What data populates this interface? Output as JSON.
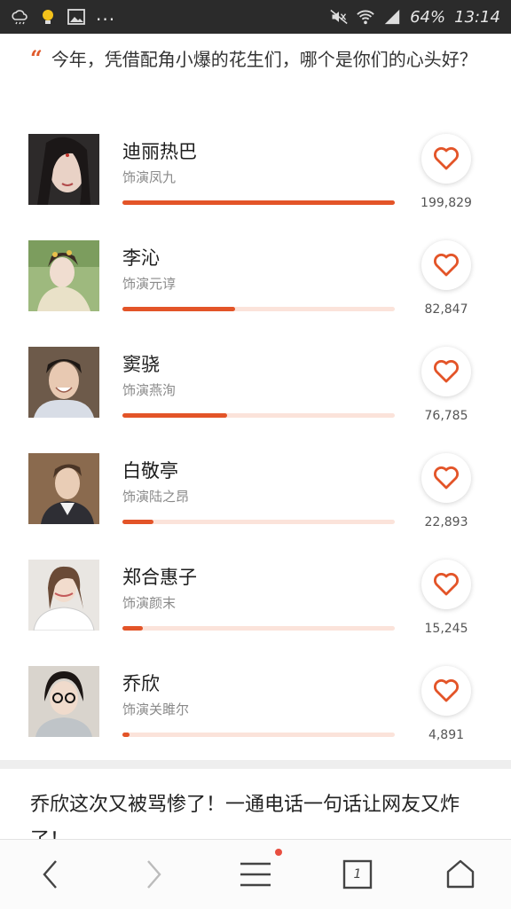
{
  "status_bar": {
    "battery": "64%",
    "time": "13:14",
    "more": "..."
  },
  "question": {
    "mark": "“",
    "text": "今年，凭借配角小爆的花生们，哪个是你们的心头好？"
  },
  "candidates": [
    {
      "name": "迪丽热巴",
      "role": "饰演凤九",
      "votes": "199,829",
      "progress": 1.0
    },
    {
      "name": "李沁",
      "role": "饰演元谆",
      "votes": "82,847",
      "progress": 0.415
    },
    {
      "name": "窦骁",
      "role": "饰演燕洵",
      "votes": "76,785",
      "progress": 0.385
    },
    {
      "name": "白敬亭",
      "role": "饰演陆之昂",
      "votes": "22,893",
      "progress": 0.115
    },
    {
      "name": "郑合惠子",
      "role": "饰演颜末",
      "votes": "15,245",
      "progress": 0.076
    },
    {
      "name": "乔欣",
      "role": "饰演关雎尔",
      "votes": "4,891",
      "progress": 0.025
    }
  ],
  "article": {
    "title": "乔欣这次又被骂惨了！一通电话一句话让网友又炸了！"
  },
  "bottom_nav": {
    "tabs_count": "1"
  },
  "colors": {
    "accent": "#e35428",
    "bar_track": "#fbe3da",
    "status_bar": "#2b2b2b"
  }
}
